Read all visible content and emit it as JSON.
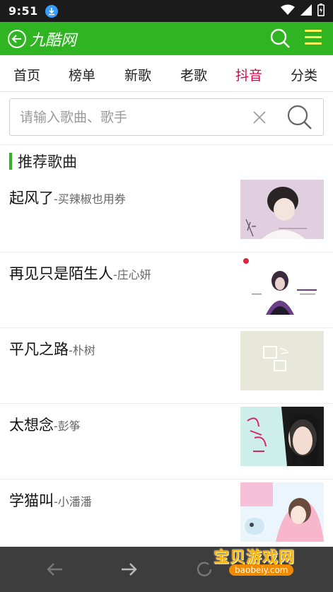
{
  "status_bar": {
    "time": "9:51"
  },
  "app_bar": {
    "brand": "九酷网"
  },
  "tabs": [
    {
      "label": "首页",
      "active": false
    },
    {
      "label": "榜单",
      "active": false
    },
    {
      "label": "新歌",
      "active": false
    },
    {
      "label": "老歌",
      "active": false
    },
    {
      "label": "抖音",
      "active": true
    },
    {
      "label": "分类",
      "active": false
    }
  ],
  "search": {
    "placeholder": "请输入歌曲、歌手",
    "value": ""
  },
  "section": {
    "title": "推荐歌曲"
  },
  "songs": [
    {
      "title": "起风了",
      "artist": "-买辣椒也用券"
    },
    {
      "title": "再见只是陌生人",
      "artist": "-庄心妍"
    },
    {
      "title": "平凡之路",
      "artist": "-朴树"
    },
    {
      "title": "太想念",
      "artist": "-彭筝"
    },
    {
      "title": "学猫叫",
      "artist": "-小潘潘"
    }
  ],
  "watermark": {
    "title": "宝贝游戏网",
    "url": "baobeiy.com"
  },
  "colors": {
    "accent_green": "#2fb522",
    "active_tab": "#e2004a",
    "menu_icon": "#fff55a"
  }
}
